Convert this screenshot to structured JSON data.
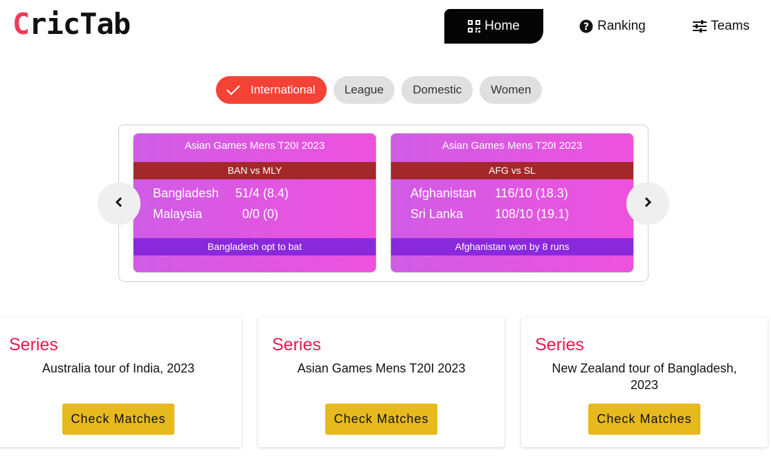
{
  "brand": {
    "logo_prefix": "C",
    "logo_rest": "ricTab"
  },
  "nav": {
    "home": "Home",
    "ranking": "Ranking",
    "teams": "Teams"
  },
  "filters": [
    "International",
    "League",
    "Domestic",
    "Women"
  ],
  "matches": [
    {
      "series": "Asian Games Mens T20I 2023",
      "teams": "BAN vs MLY",
      "rows": [
        {
          "team": "Bangladesh",
          "score": "51/4 (8.4)"
        },
        {
          "team": "Malaysia",
          "score": "0/0 (0)"
        }
      ],
      "status": "Bangladesh opt to bat"
    },
    {
      "series": "Asian Games Mens T20I 2023",
      "teams": "AFG vs SL",
      "rows": [
        {
          "team": "Afghanistan",
          "score": "116/10 (18.3)"
        },
        {
          "team": "Sri Lanka",
          "score": "108/10 (19.1)"
        }
      ],
      "status": "Afghanistan won by 8 runs"
    }
  ],
  "series_cards": [
    {
      "label": "Series",
      "name": "Australia tour of India, 2023",
      "button": "Check Matches"
    },
    {
      "label": "Series",
      "name": "Asian Games Mens T20I 2023",
      "button": "Check Matches"
    },
    {
      "label": "Series",
      "name": "New Zealand tour of Bangladesh, 2023",
      "button": "Check Matches"
    }
  ],
  "colors": {
    "brand_red": "#ef3b57",
    "active_chip": "#f44336",
    "card_gradient_start": "#d05ce6",
    "card_gradient_end": "#ee52dd",
    "teams_bar": "#a3282a",
    "status_bar": "#8a28dc",
    "series_label": "#e8194c",
    "check_button": "#e6b91e"
  },
  "icons": {
    "home": "qr-grid-icon",
    "ranking": "question-circle-icon",
    "teams": "sliders-icon",
    "chip_check": "check-icon",
    "prev": "chevron-left-icon",
    "next": "chevron-right-icon"
  }
}
